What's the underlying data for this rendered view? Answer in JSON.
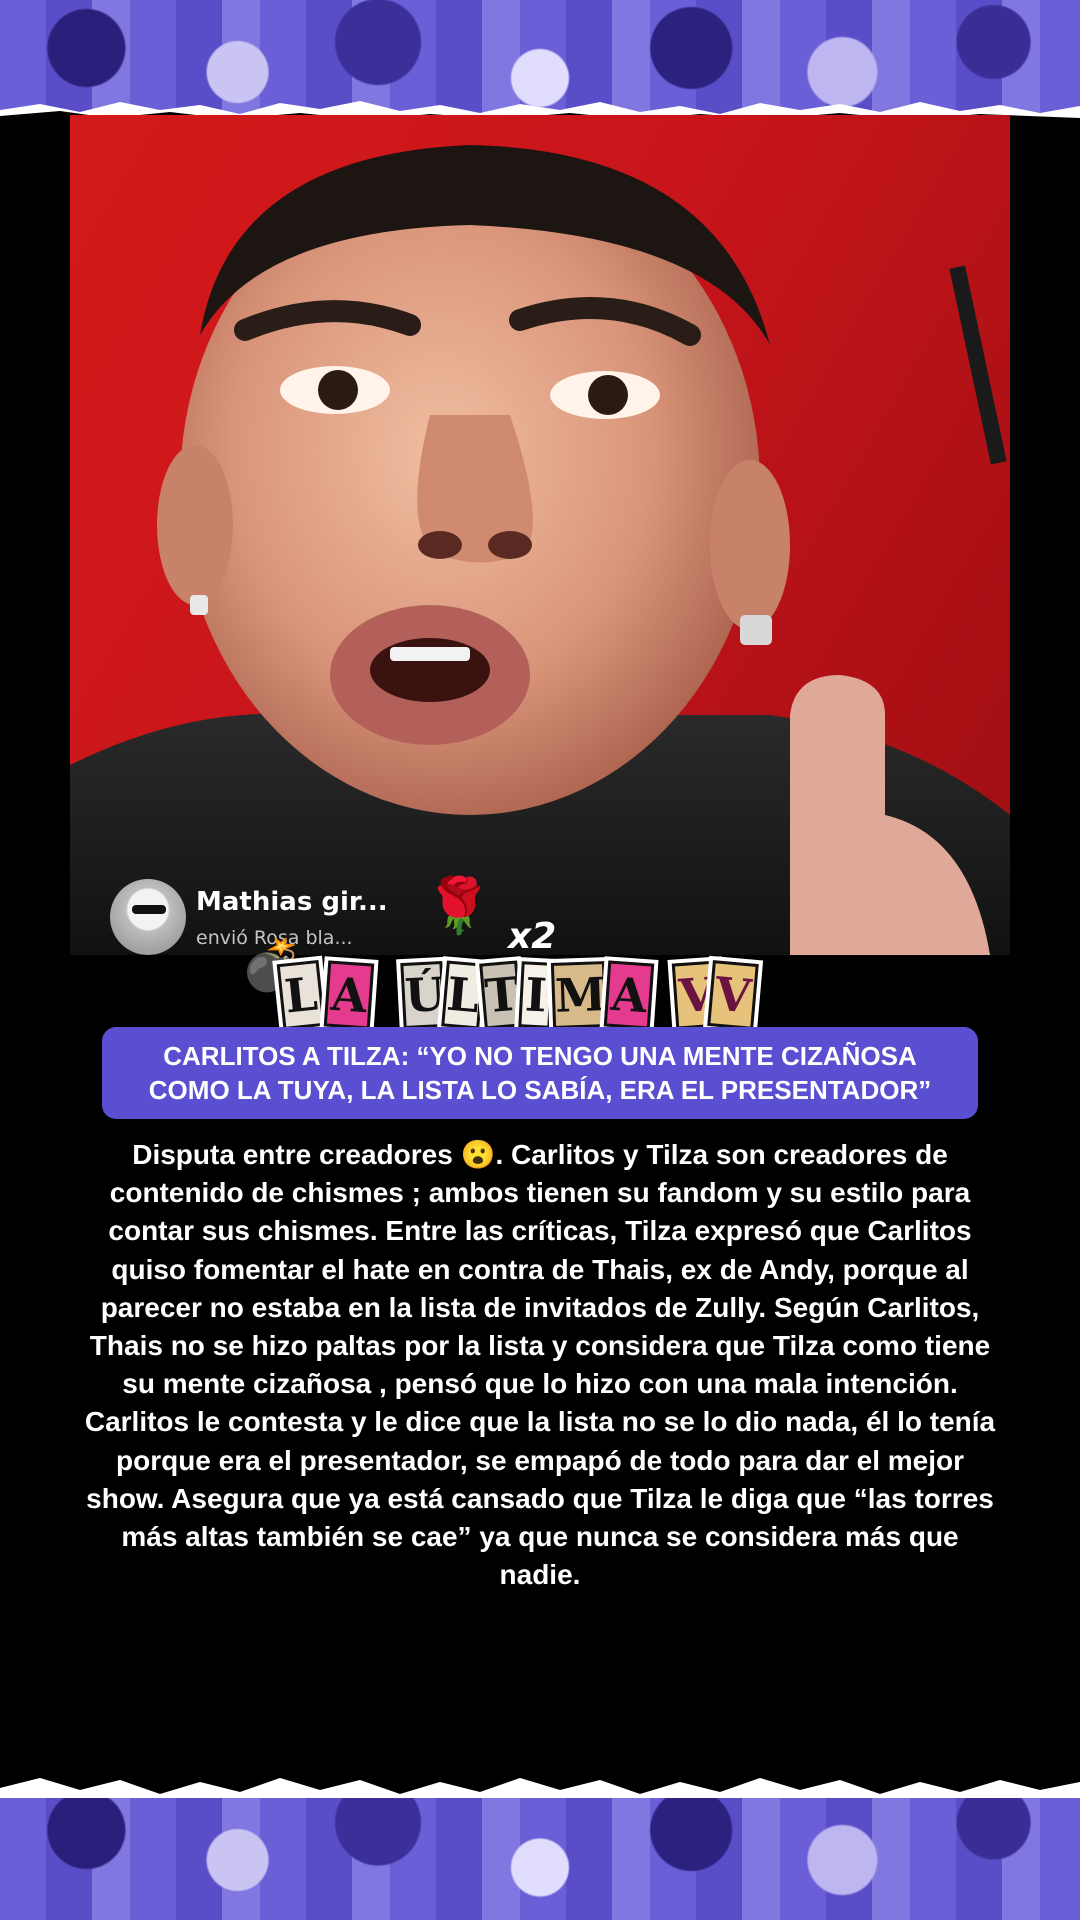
{
  "live_overlay": {
    "gift_sender": "Mathias gir...",
    "gift_message": "envió Rosa bla...",
    "gift_icon": "white-rose-icon",
    "gift_count": "x2"
  },
  "logo": {
    "letters": [
      "L",
      "A",
      "Ú",
      "L",
      "T",
      "I",
      "M",
      "A",
      "V",
      "V"
    ],
    "icons": [
      "bomb-icon",
      "surprised-face-icon"
    ]
  },
  "headline": {
    "line1": "CARLITOS A TILZA: “YO NO TENGO UNA MENTE CIZAÑOSA",
    "line2": "COMO LA TUYA, LA LISTA LO SABÍA, ERA EL PRESENTADOR”"
  },
  "article": {
    "body": "Disputa entre creadores 😮. Carlitos y Tilza son creadores de contenido de chismes ; ambos tienen su fandom y su estilo para contar sus chismes. Entre las críticas, Tilza expresó que Carlitos quiso fomentar el hate en contra de Thais, ex de Andy, porque al parecer no estaba en la lista de invitados de Zully. Según Carlitos, Thais no se hizo paltas por la lista y considera que Tilza como tiene su mente cizañosa , pensó que lo hizo con una mala intención. Carlitos le contesta y le dice que la lista no se lo dio nada, él lo tenía porque era el presentador, se empapó de todo para dar el mejor show. Asegura que ya está cansado que Tilza le diga que “las torres más altas también se cae” ya que nunca se considera más que nadie."
  },
  "colors": {
    "accent": "#5a4fd1",
    "video_background": "#c8151b",
    "page_background": "#000000"
  }
}
